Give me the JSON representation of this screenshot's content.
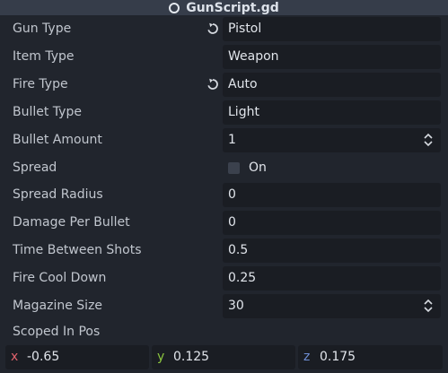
{
  "header": {
    "title": "GunScript.gd"
  },
  "properties": [
    {
      "label": "Gun Type",
      "value": "Pistol",
      "revert": true
    },
    {
      "label": "Item Type",
      "value": "Weapon",
      "revert": false
    },
    {
      "label": "Fire Type",
      "value": "Auto",
      "revert": true
    },
    {
      "label": "Bullet Type",
      "value": "Light",
      "revert": false
    },
    {
      "label": "Bullet Amount",
      "value": "1",
      "spinner": true
    },
    {
      "label": "Spread",
      "checkbox_label": "On",
      "checked": false
    },
    {
      "label": "Spread Radius",
      "value": "0"
    },
    {
      "label": "Damage Per Bullet",
      "value": "0"
    },
    {
      "label": "Time Between Shots",
      "value": "0.5"
    },
    {
      "label": "Fire Cool Down",
      "value": "0.25"
    },
    {
      "label": "Magazine Size",
      "value": "30",
      "spinner": true
    }
  ],
  "scoped_in_pos": {
    "label": "Scoped In Pos",
    "x_axis": "x",
    "x_value": "-0.65",
    "y_axis": "y",
    "y_value": "0.125",
    "z_axis": "z",
    "z_value": "0.175"
  },
  "colors": {
    "x_axis": "#e0636d",
    "y_axis": "#8cc63f",
    "z_axis": "#6f8fd6"
  }
}
